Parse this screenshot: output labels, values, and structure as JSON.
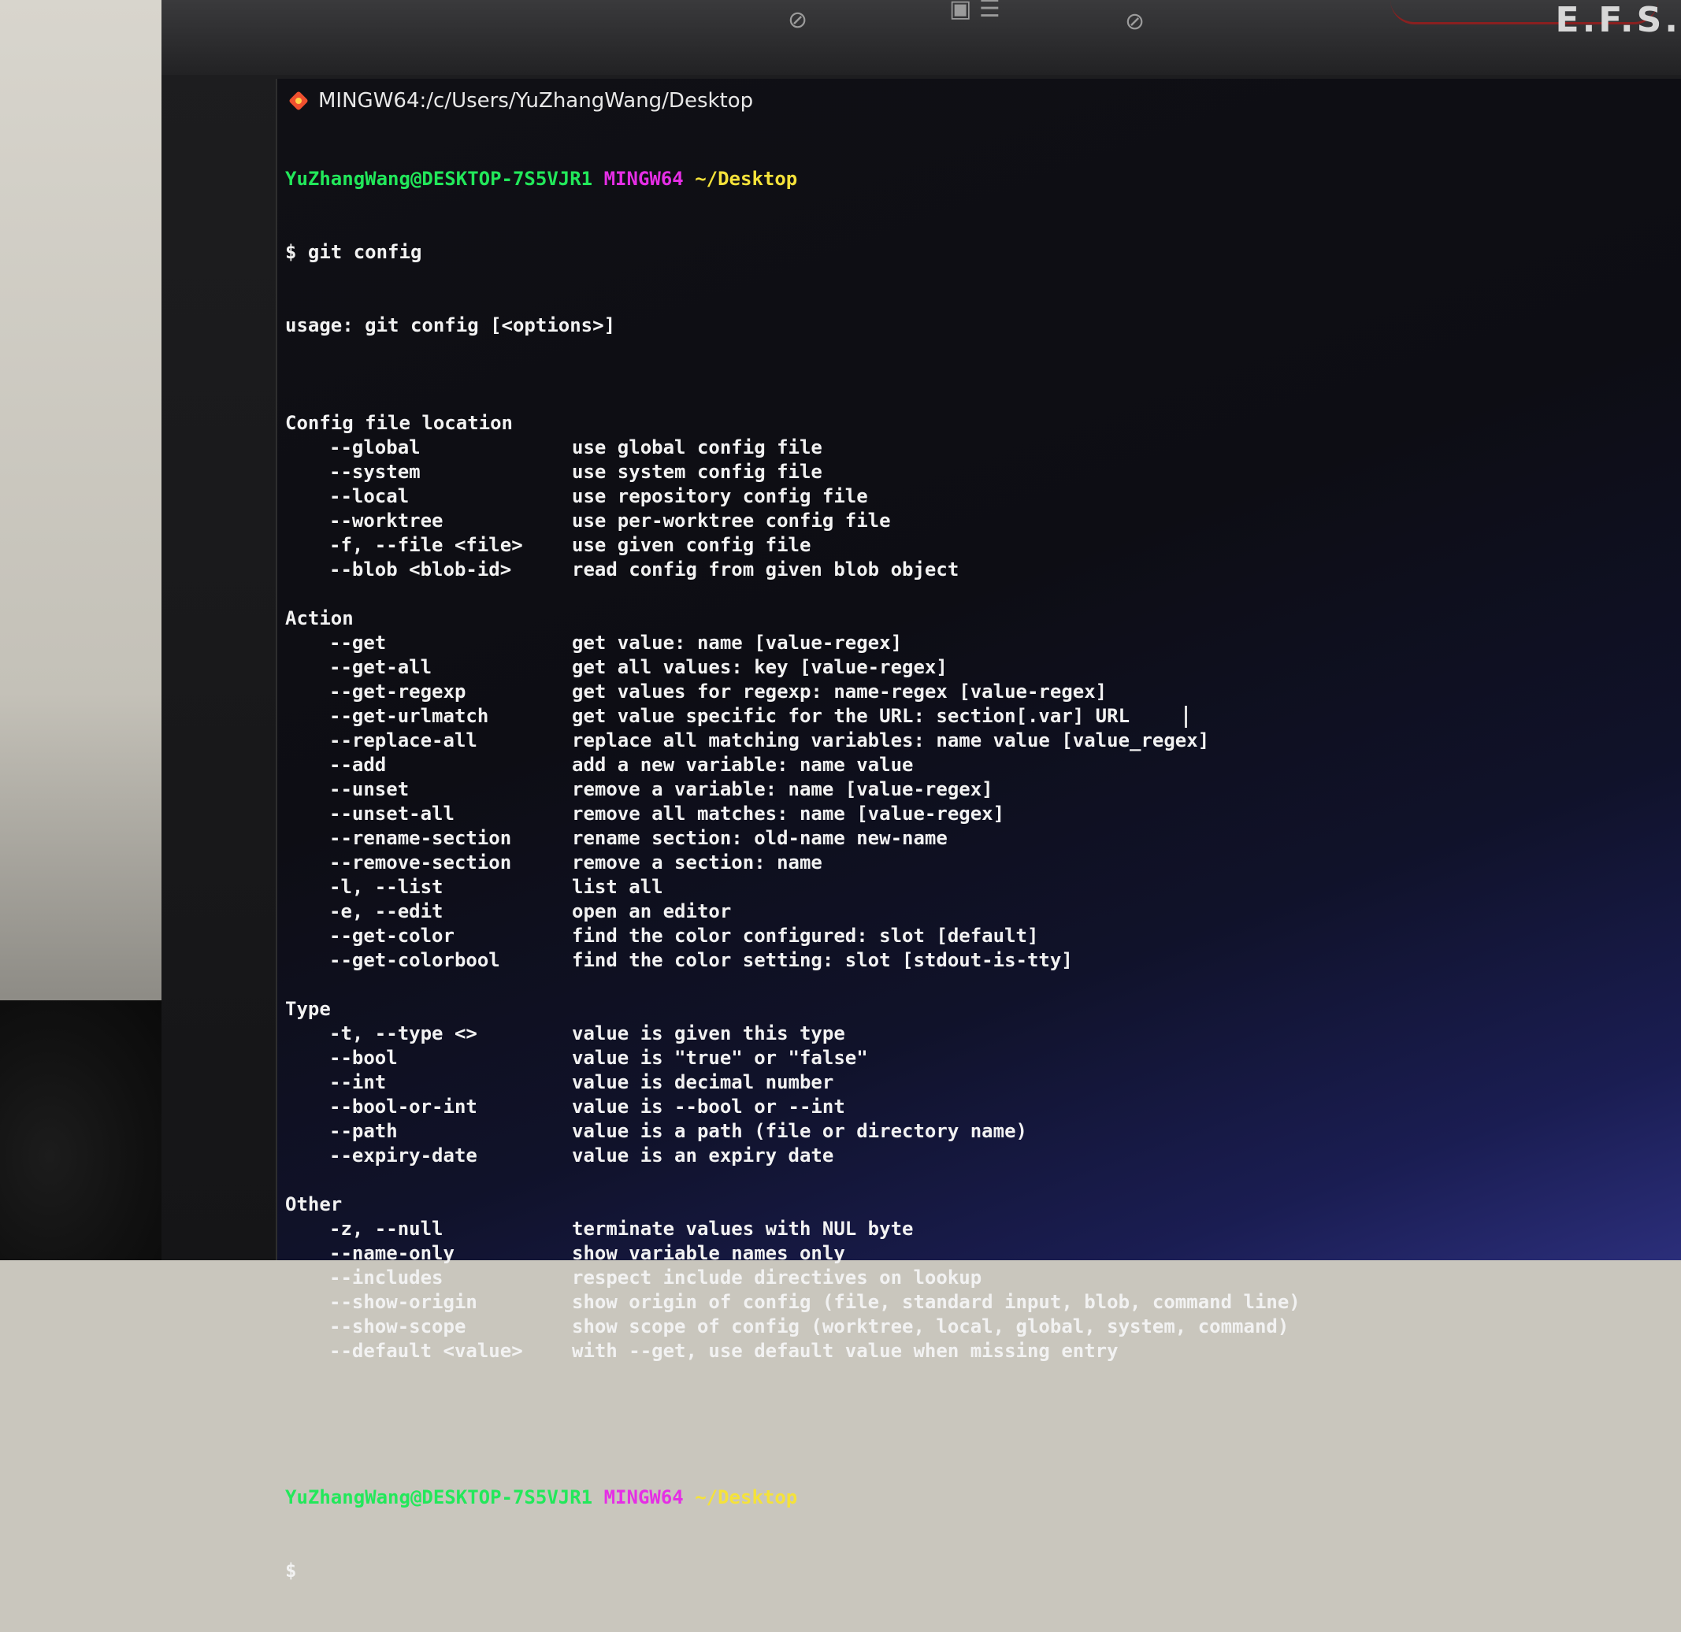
{
  "window": {
    "title": "MINGW64:/c/Users/YuZhangWang/Desktop"
  },
  "monitor": {
    "brand": "E.F.S."
  },
  "prompt": {
    "user_host": "YuZhangWang@DESKTOP-7S5VJR1",
    "shell": "MINGW64",
    "path": "~/Desktop"
  },
  "command": "$ git config",
  "usage": "usage: git config [<options>]",
  "sections": [
    {
      "heading": "Config file location",
      "options": [
        {
          "flag": "--global",
          "desc": "use global config file"
        },
        {
          "flag": "--system",
          "desc": "use system config file"
        },
        {
          "flag": "--local",
          "desc": "use repository config file"
        },
        {
          "flag": "--worktree",
          "desc": "use per-worktree config file"
        },
        {
          "flag": "-f, --file <file>",
          "desc": "use given config file"
        },
        {
          "flag": "--blob <blob-id>",
          "desc": "read config from given blob object"
        }
      ]
    },
    {
      "heading": "Action",
      "options": [
        {
          "flag": "--get",
          "desc": "get value: name [value-regex]"
        },
        {
          "flag": "--get-all",
          "desc": "get all values: key [value-regex]"
        },
        {
          "flag": "--get-regexp",
          "desc": "get values for regexp: name-regex [value-regex]"
        },
        {
          "flag": "--get-urlmatch",
          "desc": "get value specific for the URL: section[.var] URL"
        },
        {
          "flag": "--replace-all",
          "desc": "replace all matching variables: name value [value_regex]"
        },
        {
          "flag": "--add",
          "desc": "add a new variable: name value"
        },
        {
          "flag": "--unset",
          "desc": "remove a variable: name [value-regex]"
        },
        {
          "flag": "--unset-all",
          "desc": "remove all matches: name [value-regex]"
        },
        {
          "flag": "--rename-section",
          "desc": "rename section: old-name new-name"
        },
        {
          "flag": "--remove-section",
          "desc": "remove a section: name"
        },
        {
          "flag": "-l, --list",
          "desc": "list all"
        },
        {
          "flag": "-e, --edit",
          "desc": "open an editor"
        },
        {
          "flag": "--get-color",
          "desc": "find the color configured: slot [default]"
        },
        {
          "flag": "--get-colorbool",
          "desc": "find the color setting: slot [stdout-is-tty]"
        }
      ]
    },
    {
      "heading": "Type",
      "options": [
        {
          "flag": "-t, --type <>",
          "desc": "value is given this type"
        },
        {
          "flag": "--bool",
          "desc": "value is \"true\" or \"false\""
        },
        {
          "flag": "--int",
          "desc": "value is decimal number"
        },
        {
          "flag": "--bool-or-int",
          "desc": "value is --bool or --int"
        },
        {
          "flag": "--path",
          "desc": "value is a path (file or directory name)"
        },
        {
          "flag": "--expiry-date",
          "desc": "value is an expiry date"
        }
      ]
    },
    {
      "heading": "Other",
      "options": [
        {
          "flag": "-z, --null",
          "desc": "terminate values with NUL byte"
        },
        {
          "flag": "--name-only",
          "desc": "show variable names only"
        },
        {
          "flag": "--includes",
          "desc": "respect include directives on lookup"
        },
        {
          "flag": "--show-origin",
          "desc": "show origin of config (file, standard input, blob, command line)"
        },
        {
          "flag": "--show-scope",
          "desc": "show scope of config (worktree, local, global, system, command)"
        },
        {
          "flag": "--default <value>",
          "desc": "with --get, use default value when missing entry"
        }
      ]
    }
  ],
  "final_prompt_symbol": "$"
}
